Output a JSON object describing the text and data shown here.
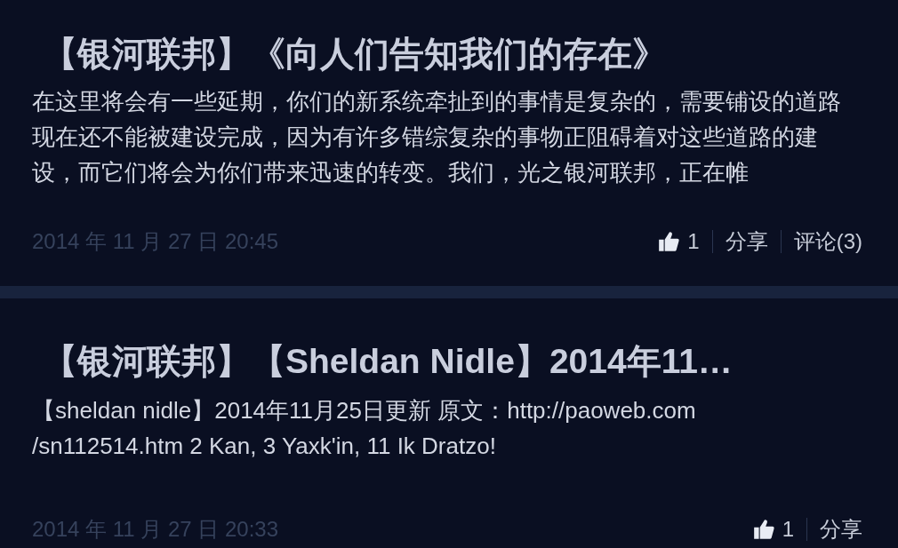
{
  "posts": [
    {
      "title": "【银河联邦】《向人们告知我们的存在》",
      "excerpt": "在这里将会有一些延期，你们的新系统牵扯到的事情是复杂的，需要铺设的道路现在还不能被建设完成，因为有许多错综复杂的事物正阻碍着对这些道路的建设，而它们将会为你们带来迅速的转变。我们，光之银河联邦，正在帷",
      "date": "2014 年 11 月 27 日 20:45",
      "likes": "1",
      "actions": [
        "分享",
        "评论(3)"
      ]
    },
    {
      "title": "【银河联邦】【Sheldan Nidle】2014年11…",
      "excerpt": "【sheldan nidle】2014年11月25日更新 原文：http://paoweb.com /sn112514.htm 2 Kan, 3 Yaxk'in, 11 Ik Dratzo!",
      "date": "2014 年 11 月 27 日 20:33",
      "likes": "1",
      "actions": [
        "分享"
      ]
    }
  ]
}
